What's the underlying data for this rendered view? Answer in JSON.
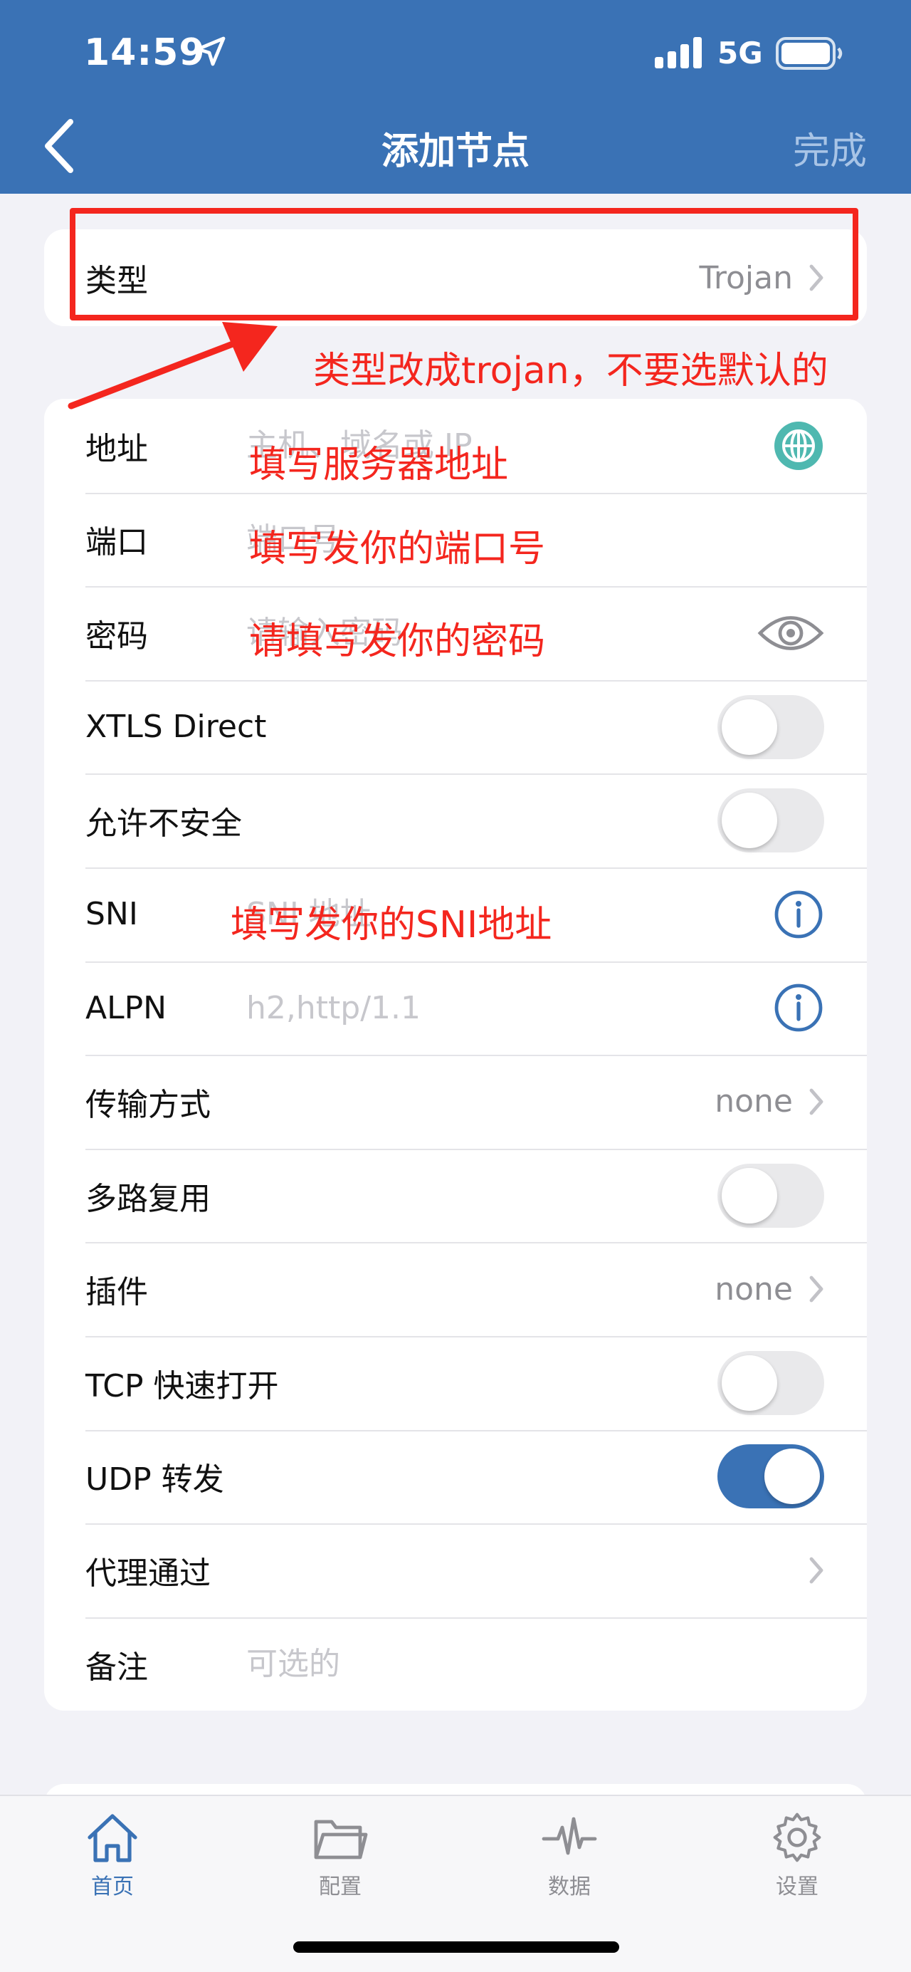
{
  "status_bar": {
    "time": "14:59",
    "network": "5G"
  },
  "nav": {
    "title": "添加节点",
    "done_label": "完成"
  },
  "type_row": {
    "label": "类型",
    "value": "Trojan"
  },
  "form": {
    "address": {
      "label": "地址",
      "placeholder": "主机、域名或 IP"
    },
    "port": {
      "label": "端口",
      "placeholder": "端口号"
    },
    "password": {
      "label": "密码",
      "placeholder": "请输入密码"
    },
    "xtls": {
      "label": "XTLS Direct",
      "on": false
    },
    "allow_insecure": {
      "label": "允许不安全",
      "on": false
    },
    "sni": {
      "label": "SNI",
      "placeholder": "SNI 地址"
    },
    "alpn": {
      "label": "ALPN",
      "placeholder": "h2,http/1.1"
    },
    "transport": {
      "label": "传输方式",
      "value": "none"
    },
    "mux": {
      "label": "多路复用",
      "on": false
    },
    "plugin": {
      "label": "插件",
      "value": "none"
    },
    "tcp_fast_open": {
      "label": "TCP 快速打开",
      "on": false
    },
    "udp_relay": {
      "label": "UDP 转发",
      "on": true
    },
    "proxy_via": {
      "label": "代理通过"
    },
    "remark": {
      "label": "备注",
      "placeholder": "可选的"
    }
  },
  "annotations": {
    "type_hint": "类型改成trojan，不要选默认的",
    "address_hint": "填写服务器地址",
    "port_hint": "填写发你的端口号",
    "password_hint": "请填写发你的密码",
    "sni_hint": "填写发你的SNI地址"
  },
  "tabs": [
    {
      "label": "首页",
      "icon": "home-icon",
      "active": true
    },
    {
      "label": "配置",
      "icon": "folder-icon",
      "active": false
    },
    {
      "label": "数据",
      "icon": "pulse-icon",
      "active": false
    },
    {
      "label": "设置",
      "icon": "gear-icon",
      "active": false
    }
  ],
  "colors": {
    "header": "#3a72b5",
    "annotation": "#f4261e",
    "toggle_on": "#3a72b5",
    "globe": "#4fb8b0"
  }
}
